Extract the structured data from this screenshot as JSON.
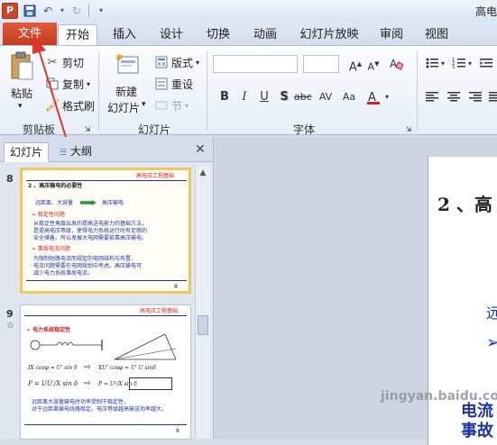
{
  "window": {
    "title": "高电"
  },
  "qat": {
    "app_letter": "P",
    "save": "save-icon",
    "undo": "undo-icon",
    "redo": "redo-icon"
  },
  "tabs": {
    "file": "文件",
    "items": [
      "开始",
      "插入",
      "设计",
      "切换",
      "动画",
      "幻灯片放映",
      "审阅",
      "视图"
    ]
  },
  "ribbon": {
    "clipboard": {
      "paste": "粘贴",
      "cut": "剪切",
      "copy": "复制",
      "format_painter": "格式刷",
      "group": "剪贴板"
    },
    "slides": {
      "new_slide": "新建",
      "new_slide2": "幻灯片",
      "layout": "版式",
      "reset": "重设",
      "section": "节",
      "group": "幻灯片"
    },
    "font": {
      "group": "字体"
    }
  },
  "panel": {
    "tab_slides": "幻灯片",
    "tab_outline": "大纲",
    "close": "✕"
  },
  "slides": [
    {
      "number": "8",
      "header": "高电压工程基础",
      "title": "2 、高压输电的必要性",
      "lines": [
        "远距离、大容量",
        "高压输电",
        "➢ 稳定性问题",
        "从稳定性角度出发的提高送电能力的基础方法，",
        "是提高电压等级，使得电力系统运行时有足够的",
        "安全储备。所以发展大电网需要依靠高压输电。",
        "➢ 事故电流问题",
        "为限制短路电流而规定的电网结构与布置，",
        "电流问题需要在电网规划中考虑。高压输电可",
        "减少电力系统事故电流。"
      ],
      "page": "8"
    },
    {
      "number": "9",
      "header": "高电压工程基础",
      "title": "➢ 电力系统稳定性",
      "formula1": "IX cosφ = U' sin δ",
      "formula2": "XU' cosφ = U' U sinδ",
      "formula3": "P = UU'/X sin δ",
      "formula4": "P = U²/X sin δ",
      "lines": [
        "远距离大容量输电时功率受制于稳定性，",
        "对于远距离输电线路稳定，电压等级越高输送功率越大。"
      ],
      "page": "9"
    }
  ],
  "main_slide": {
    "title": "2 、高",
    "line1": "远",
    "bullet": "➢",
    "line2": "电流",
    "line3": "事故"
  },
  "watermark": "jingyan.baidu.com"
}
